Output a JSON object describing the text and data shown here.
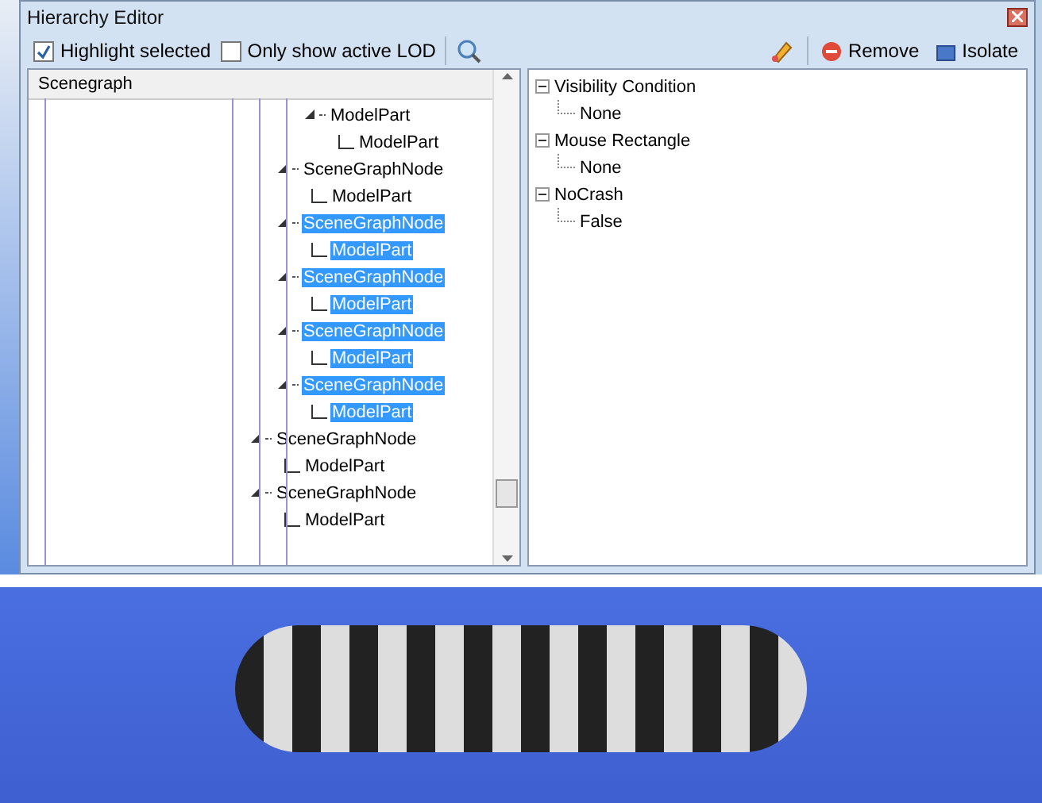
{
  "window": {
    "title": "Hierarchy Editor"
  },
  "toolbar": {
    "checkboxes": [
      {
        "label": "Highlight selected",
        "checked": true
      },
      {
        "label": "Only show active LOD",
        "checked": false
      }
    ],
    "buttons": [
      {
        "kind": "tool"
      },
      {
        "kind": "remove",
        "label": "Remove"
      },
      {
        "kind": "isolate",
        "label": "Isolate"
      }
    ]
  },
  "scenegraph": {
    "header": "Scenegraph",
    "tree": [
      {
        "children": [
          {
            "children": [
              {
                "label": "ModelPart",
                "selected": false,
                "expanded": true,
                "children": [
                  {
                    "label": "ModelPart",
                    "selected": false
                  }
                ]
              }
            ]
          },
          {
            "label": "SceneGraphNode",
            "selected": false,
            "expanded": true,
            "children": [
              {
                "label": "ModelPart",
                "selected": false
              }
            ]
          },
          {
            "label": "SceneGraphNode",
            "selected": true,
            "expanded": true,
            "children": [
              {
                "label": "ModelPart",
                "selected": true
              }
            ]
          },
          {
            "label": "SceneGraphNode",
            "selected": true,
            "expanded": true,
            "children": [
              {
                "label": "ModelPart",
                "selected": true
              }
            ]
          },
          {
            "label": "SceneGraphNode",
            "selected": true,
            "expanded": true,
            "children": [
              {
                "label": "ModelPart",
                "selected": true
              }
            ]
          },
          {
            "label": "SceneGraphNode",
            "selected": true,
            "expanded": true,
            "children": [
              {
                "label": "ModelPart",
                "selected": true
              }
            ]
          }
        ]
      },
      {
        "label": "SceneGraphNode",
        "selected": false,
        "expanded": true,
        "children": [
          {
            "label": "ModelPart",
            "selected": false
          }
        ]
      },
      {
        "label": "SceneGraphNode",
        "selected": false,
        "expanded": true,
        "children": [
          {
            "label": "ModelPart",
            "selected": false
          }
        ]
      }
    ]
  },
  "properties": [
    {
      "label": "Visibility Condition",
      "expanded": true,
      "children": [
        {
          "label": "None"
        }
      ]
    },
    {
      "label": "Mouse Rectangle",
      "expanded": true,
      "children": [
        {
          "label": "None"
        }
      ]
    },
    {
      "label": "NoCrash",
      "expanded": true,
      "children": [
        {
          "label": "False"
        }
      ]
    }
  ]
}
